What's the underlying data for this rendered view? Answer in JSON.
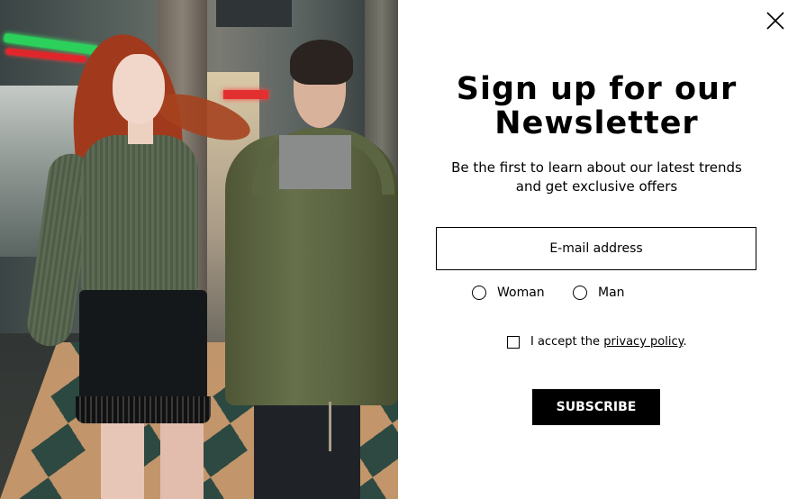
{
  "modal": {
    "title_line1": "Sign up for our",
    "title_line2": "Newsletter",
    "subtitle_line1": "Be the first to learn about our latest trends",
    "subtitle_line2": "and get exclusive offers",
    "email": {
      "placeholder": "E-mail address",
      "value": ""
    },
    "gender_options": [
      {
        "label": "Woman",
        "selected": false
      },
      {
        "label": "Man",
        "selected": false
      }
    ],
    "accept": {
      "prefix": "I accept the",
      "link_text": "privacy policy",
      "suffix": ".",
      "checked": false
    },
    "subscribe_label": "SUBSCRIBE",
    "close_icon": "close-icon"
  },
  "colors": {
    "text": "#000000",
    "background": "#ffffff",
    "button_bg": "#000000",
    "button_text": "#ffffff"
  }
}
